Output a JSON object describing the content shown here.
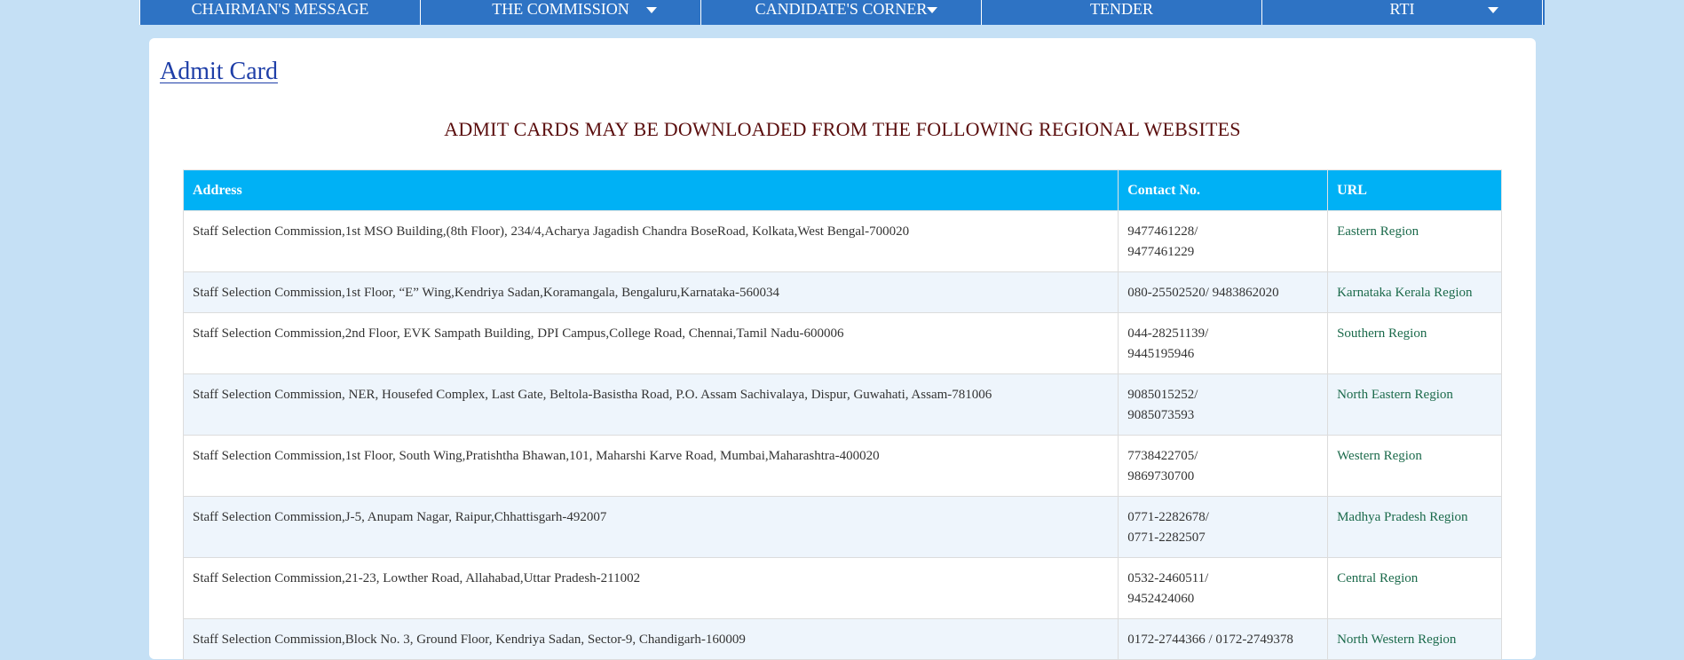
{
  "nav": {
    "items": [
      {
        "label": "CHAIRMAN'S MESSAGE",
        "dropdown": false
      },
      {
        "label": "THE COMMISSION",
        "dropdown": true
      },
      {
        "label": "CANDIDATE'S CORNER",
        "dropdown": true
      },
      {
        "label": "TENDER",
        "dropdown": false
      },
      {
        "label": "RTI",
        "dropdown": true
      }
    ]
  },
  "page": {
    "title": "Admit Card",
    "subheading": "ADMIT CARDS MAY BE DOWNLOADED FROM THE FOLLOWING REGIONAL WEBSITES"
  },
  "table": {
    "headers": [
      "Address",
      "Contact No.",
      "URL"
    ],
    "rows": [
      {
        "address": "Staff Selection Commission,1st MSO Building,(8th Floor), 234/4,Acharya Jagadish Chandra BoseRoad, Kolkata,West Bengal-700020",
        "contact": [
          "9477461228/",
          "9477461229"
        ],
        "url": "Eastern Region"
      },
      {
        "address": "Staff Selection Commission,1st Floor, “E” Wing,Kendriya Sadan,Koramangala, Bengaluru,Karnataka-560034",
        "contact": [
          "080-25502520/ 9483862020"
        ],
        "url": "Karnataka Kerala Region"
      },
      {
        "address": "Staff Selection Commission,2nd Floor, EVK Sampath Building, DPI Campus,College Road, Chennai,Tamil Nadu-600006",
        "contact": [
          "044-28251139/",
          "9445195946"
        ],
        "url": "Southern Region"
      },
      {
        "address": "Staff Selection Commission, NER, Housefed Complex, Last Gate, Beltola-Basistha Road, P.O. Assam Sachivalaya, Dispur, Guwahati, Assam-781006",
        "contact": [
          "9085015252/",
          "9085073593"
        ],
        "url": "North Eastern Region"
      },
      {
        "address": "Staff Selection Commission,1st Floor, South Wing,Pratishtha Bhawan,101, Maharshi Karve Road, Mumbai,Maharashtra-400020",
        "contact": [
          "7738422705/",
          "9869730700"
        ],
        "url": "Western Region"
      },
      {
        "address": "Staff Selection Commission,J-5, Anupam Nagar, Raipur,Chhattisgarh-492007",
        "contact": [
          "0771-2282678/",
          "0771-2282507"
        ],
        "url": "Madhya Pradesh Region"
      },
      {
        "address": "Staff Selection Commission,21-23, Lowther Road, Allahabad,Uttar Pradesh-211002",
        "contact": [
          "0532-2460511/",
          "9452424060"
        ],
        "url": "Central Region"
      },
      {
        "address": "Staff Selection Commission,Block No. 3, Ground Floor, Kendriya Sadan, Sector-9, Chandigarh-160009",
        "contact": [
          "0172-2744366 / 0172-2749378"
        ],
        "url": "North Western Region"
      }
    ]
  },
  "colors": {
    "nav_bg": "#2e73c4",
    "page_bg": "#c5e0f5",
    "header_bg": "#00b1f5",
    "title_link": "#1f3fa8",
    "subheading": "#5a0d0d",
    "url_link": "#1b6a4b"
  }
}
